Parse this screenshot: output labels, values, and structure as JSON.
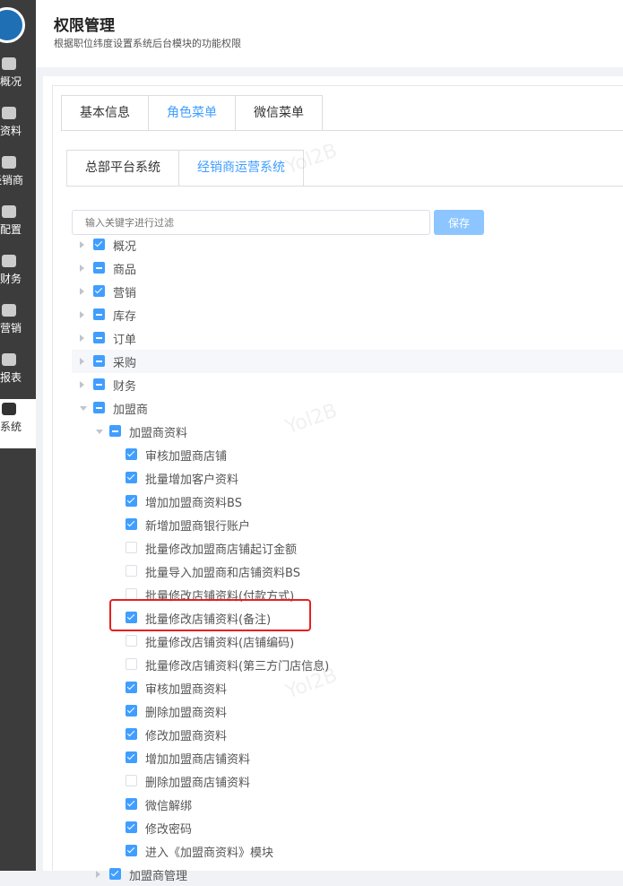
{
  "sidebar": {
    "items": [
      {
        "label": "概况",
        "icon": "building-icon"
      },
      {
        "label": "资料",
        "icon": "document-icon"
      },
      {
        "label": "经销商",
        "icon": "person-icon"
      },
      {
        "label": "配置",
        "icon": "wechat-icon"
      },
      {
        "label": "财务",
        "icon": "coins-icon"
      },
      {
        "label": "营销",
        "icon": "tag-icon"
      },
      {
        "label": "报表",
        "icon": "chart-icon"
      },
      {
        "label": "系统",
        "icon": "gear-icon",
        "active": true
      }
    ]
  },
  "header": {
    "title": "权限管理",
    "subtitle": "根据职位纬度设置系统后台模块的功能权限"
  },
  "tabs": [
    "基本信息",
    "角色菜单",
    "微信菜单"
  ],
  "subtabs": [
    "总部平台系统",
    "经销商运营系统"
  ],
  "filter": {
    "placeholder": "输入关键字进行过滤",
    "save": "保存"
  },
  "tree": [
    {
      "label": "概况",
      "level": 0,
      "state": "checked",
      "arrow": "closed"
    },
    {
      "label": "商品",
      "level": 0,
      "state": "indeterminate",
      "arrow": "closed"
    },
    {
      "label": "营销",
      "level": 0,
      "state": "checked",
      "arrow": "closed"
    },
    {
      "label": "库存",
      "level": 0,
      "state": "indeterminate",
      "arrow": "closed"
    },
    {
      "label": "订单",
      "level": 0,
      "state": "indeterminate",
      "arrow": "closed"
    },
    {
      "label": "采购",
      "level": 0,
      "state": "indeterminate",
      "arrow": "closed",
      "highlight": true
    },
    {
      "label": "财务",
      "level": 0,
      "state": "indeterminate",
      "arrow": "closed"
    },
    {
      "label": "加盟商",
      "level": 0,
      "state": "indeterminate",
      "arrow": "open"
    },
    {
      "label": "加盟商资料",
      "level": 1,
      "state": "indeterminate",
      "arrow": "open"
    },
    {
      "label": "审核加盟商店铺",
      "level": 2,
      "state": "checked"
    },
    {
      "label": "批量增加客户资料",
      "level": 2,
      "state": "checked"
    },
    {
      "label": "增加加盟商资料BS",
      "level": 2,
      "state": "checked"
    },
    {
      "label": "新增加盟商银行账户",
      "level": 2,
      "state": "checked"
    },
    {
      "label": "批量修改加盟商店铺起订金额",
      "level": 2,
      "state": "unchecked"
    },
    {
      "label": "批量导入加盟商和店铺资料BS",
      "level": 2,
      "state": "unchecked"
    },
    {
      "label": "批量修改店铺资料(付款方式)",
      "level": 2,
      "state": "unchecked"
    },
    {
      "label": "批量修改店铺资料(备注)",
      "level": 2,
      "state": "checked"
    },
    {
      "label": "批量修改店铺资料(店铺编码)",
      "level": 2,
      "state": "unchecked"
    },
    {
      "label": "批量修改店铺资料(第三方门店信息)",
      "level": 2,
      "state": "unchecked"
    },
    {
      "label": "审核加盟商资料",
      "level": 2,
      "state": "checked"
    },
    {
      "label": "删除加盟商资料",
      "level": 2,
      "state": "checked"
    },
    {
      "label": "修改加盟商资料",
      "level": 2,
      "state": "checked"
    },
    {
      "label": "增加加盟商店铺资料",
      "level": 2,
      "state": "checked"
    },
    {
      "label": "删除加盟商店铺资料",
      "level": 2,
      "state": "unchecked"
    },
    {
      "label": "微信解绑",
      "level": 2,
      "state": "checked"
    },
    {
      "label": "修改密码",
      "level": 2,
      "state": "checked"
    },
    {
      "label": "进入《加盟商资料》模块",
      "level": 2,
      "state": "checked"
    },
    {
      "label": "加盟商管理",
      "level": 1,
      "state": "checked",
      "arrow": "closed"
    }
  ],
  "watermark": "Yol2B"
}
